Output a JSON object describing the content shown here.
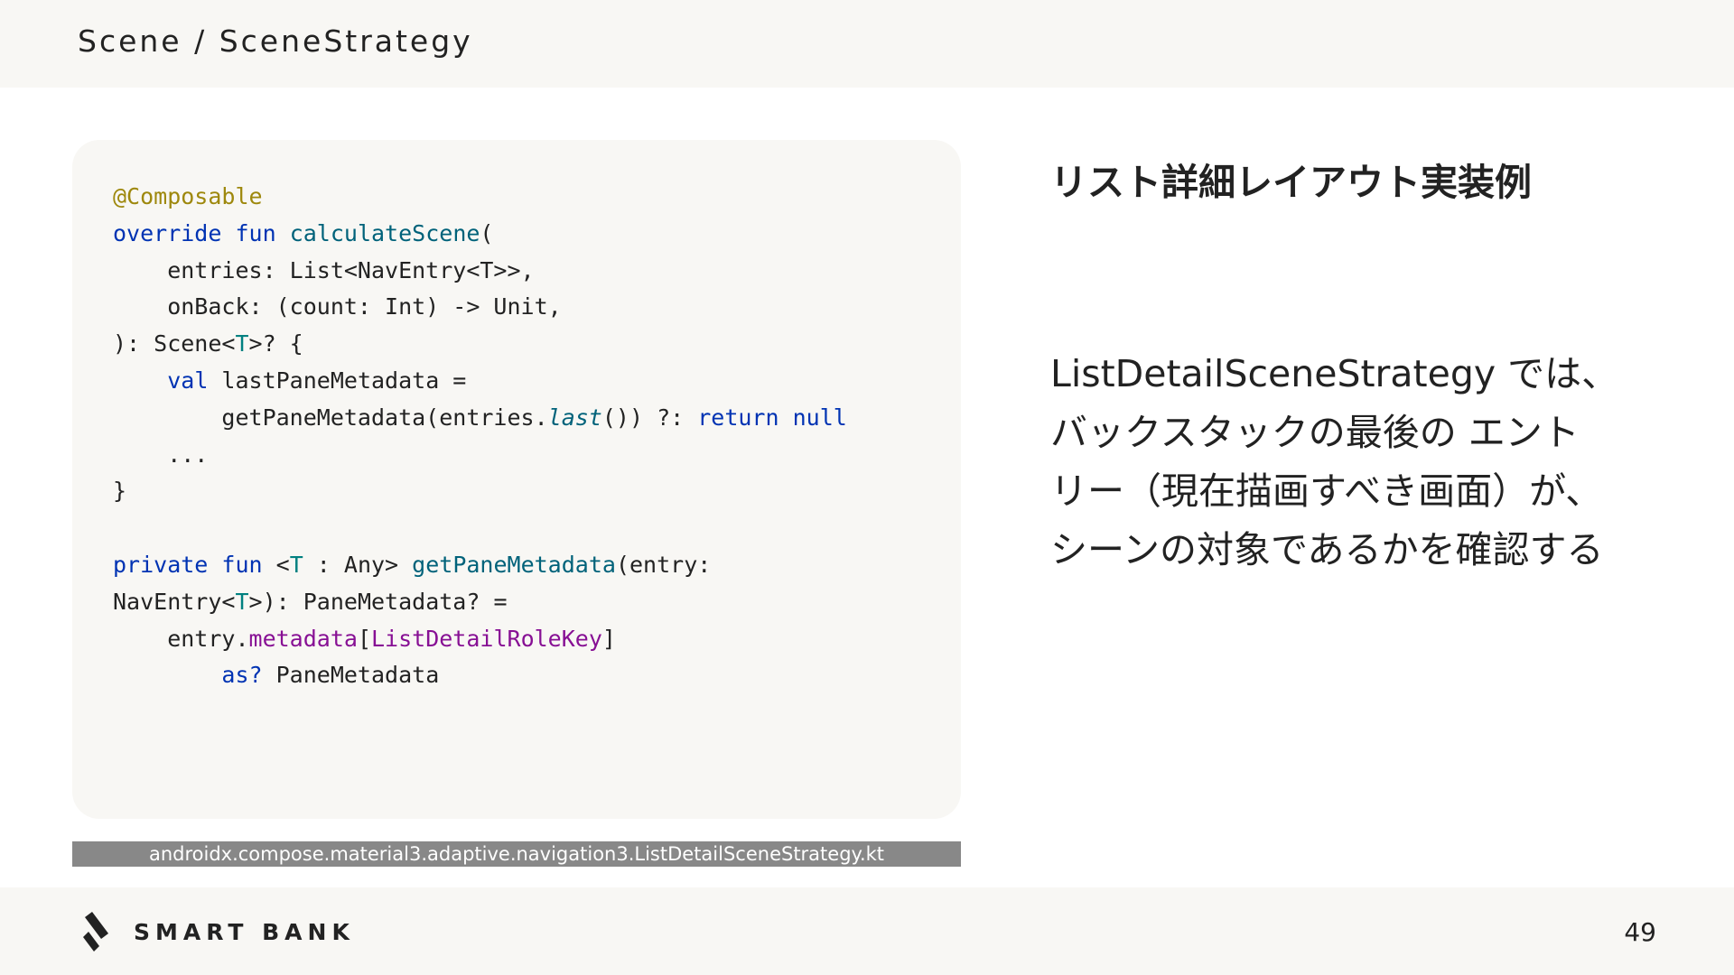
{
  "header": {
    "breadcrumb": "Scene / SceneStrategy"
  },
  "code": {
    "lines": [
      [
        {
          "t": "@Composable",
          "c": "annotation"
        }
      ],
      [
        {
          "t": "override",
          "c": "keyword"
        },
        {
          "t": " "
        },
        {
          "t": "fun",
          "c": "keyword"
        },
        {
          "t": " "
        },
        {
          "t": "calculateScene",
          "c": "fn"
        },
        {
          "t": "("
        }
      ],
      [
        {
          "t": "    entries: List<NavEntry<T>>,"
        }
      ],
      [
        {
          "t": "    onBack: (count: Int) -> Unit,"
        }
      ],
      [
        {
          "t": "): Scene<"
        },
        {
          "t": "T",
          "c": "type"
        },
        {
          "t": ">? {"
        }
      ],
      [
        {
          "t": "    "
        },
        {
          "t": "val",
          "c": "keyword"
        },
        {
          "t": " lastPaneMetadata ="
        }
      ],
      [
        {
          "t": "        getPaneMetadata(entries."
        },
        {
          "t": "last",
          "c": "ext"
        },
        {
          "t": "()) ?: "
        },
        {
          "t": "return",
          "c": "keyword"
        },
        {
          "t": " "
        },
        {
          "t": "null",
          "c": "kw-null"
        }
      ],
      [
        {
          "t": "    ..."
        }
      ],
      [
        {
          "t": "}"
        }
      ],
      [
        {
          "t": ""
        }
      ],
      [
        {
          "t": "private",
          "c": "keyword"
        },
        {
          "t": " "
        },
        {
          "t": "fun",
          "c": "keyword"
        },
        {
          "t": " <"
        },
        {
          "t": "T",
          "c": "type"
        },
        {
          "t": " : Any> "
        },
        {
          "t": "getPaneMetadata",
          "c": "fn"
        },
        {
          "t": "(entry:"
        }
      ],
      [
        {
          "t": "NavEntry<"
        },
        {
          "t": "T",
          "c": "type"
        },
        {
          "t": ">): PaneMetadata? ="
        }
      ],
      [
        {
          "t": "    entry."
        },
        {
          "t": "metadata",
          "c": "prop"
        },
        {
          "t": "["
        },
        {
          "t": "ListDetailRoleKey",
          "c": "prop"
        },
        {
          "t": "]"
        }
      ],
      [
        {
          "t": "        "
        },
        {
          "t": "as?",
          "c": "keyword"
        },
        {
          "t": " PaneMetadata"
        }
      ]
    ]
  },
  "caption": "androidx.compose.material3.adaptive.navigation3.ListDetailSceneStrategy.kt",
  "section_title": "リスト詳細レイアウト実装例",
  "description": {
    "lines": [
      "ListDetailSceneStrategy では、",
      "バックスタックの最後の エント",
      "リー（現在描画すべき画面）が、",
      "シーンの対象であるかを確認する"
    ]
  },
  "footer": {
    "logo_text": "SMART BANK",
    "page_number": "49"
  },
  "colors": {
    "background": "#ffffff",
    "band": "#f8f7f4",
    "code_annotation": "#9e880d",
    "code_keyword": "#0033b3",
    "code_function": "#00627a",
    "code_type": "#008080",
    "code_property": "#871094",
    "caption_bg": "#888888"
  }
}
